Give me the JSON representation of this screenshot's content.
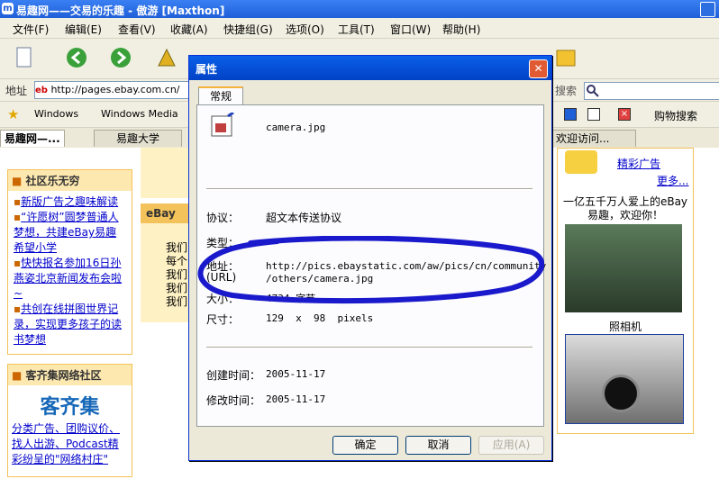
{
  "window": {
    "title": "易趣网——交易的乐趣 - 傲游 [Maxthon]"
  },
  "menu": [
    "文件(F)",
    "编辑(E)",
    "查看(V)",
    "收藏(A)",
    "快捷组(G)",
    "选项(O)",
    "工具(T)",
    "窗口(W)",
    "帮助(H)"
  ],
  "address": {
    "label": "地址",
    "url": "http://pages.ebay.com.cn/",
    "search_label": "搜索"
  },
  "favorites": {
    "items": [
      "Windows",
      "Windows Media"
    ],
    "shopping": "购物搜索"
  },
  "tabs": [
    "易趣网—...",
    "易趣大学",
    "欢迎访问..."
  ],
  "page": {
    "community_title": "社区乐无穷",
    "community_links": [
      "新版广告之趣味解读",
      "“许愿树”圆梦普通人梦想，共建eBay易趣希望小学",
      "快快报名参加16日孙燕姿北京新闻发布会啦~",
      "共创在线拼图世界记录，实现更多孩子的读书梦想"
    ],
    "kqj_title": "客齐集网络社区",
    "kqj_logo": "客齐集",
    "kqj_text": "分类广告、团购议价、找人出游、Podcast精彩纷呈的\"网络村庄\"",
    "ebay_label": "eBay",
    "me_items": [
      "我们",
      "每个",
      "我们",
      "我们",
      "我们"
    ],
    "right_ad_link": "精彩广告",
    "right_more": "更多...",
    "right_headline": "一亿五千万人爱上的eBay易趣，欢迎你！",
    "camera_caption": "照相机"
  },
  "dialog": {
    "title": "属性",
    "tab": "常规",
    "filename": "camera.jpg",
    "protocol_label": "协议：",
    "protocol_value": "超文本传送协议",
    "type_label": "类型：",
    "address_label": "地址：",
    "url_label": "(URL)",
    "address_line1": "http://pics.ebaystatic.com/aw/pics/cn/community",
    "address_line2": "/others/camera.jpg",
    "size_label": "大小：",
    "size_value": "4734 字节",
    "dim_label": "尺寸：",
    "dim_value": "129  x  98  pixels",
    "created_label": "创建时间：",
    "created_value": "2005-11-17",
    "modified_label": "修改时间：",
    "modified_value": "2005-11-17",
    "ok": "确定",
    "cancel": "取消",
    "apply": "应用(A)"
  },
  "colors": {
    "annotation": "#1a1acc",
    "xp_blue": "#0a5fe8",
    "ebay_orange": "#f3c25a"
  }
}
